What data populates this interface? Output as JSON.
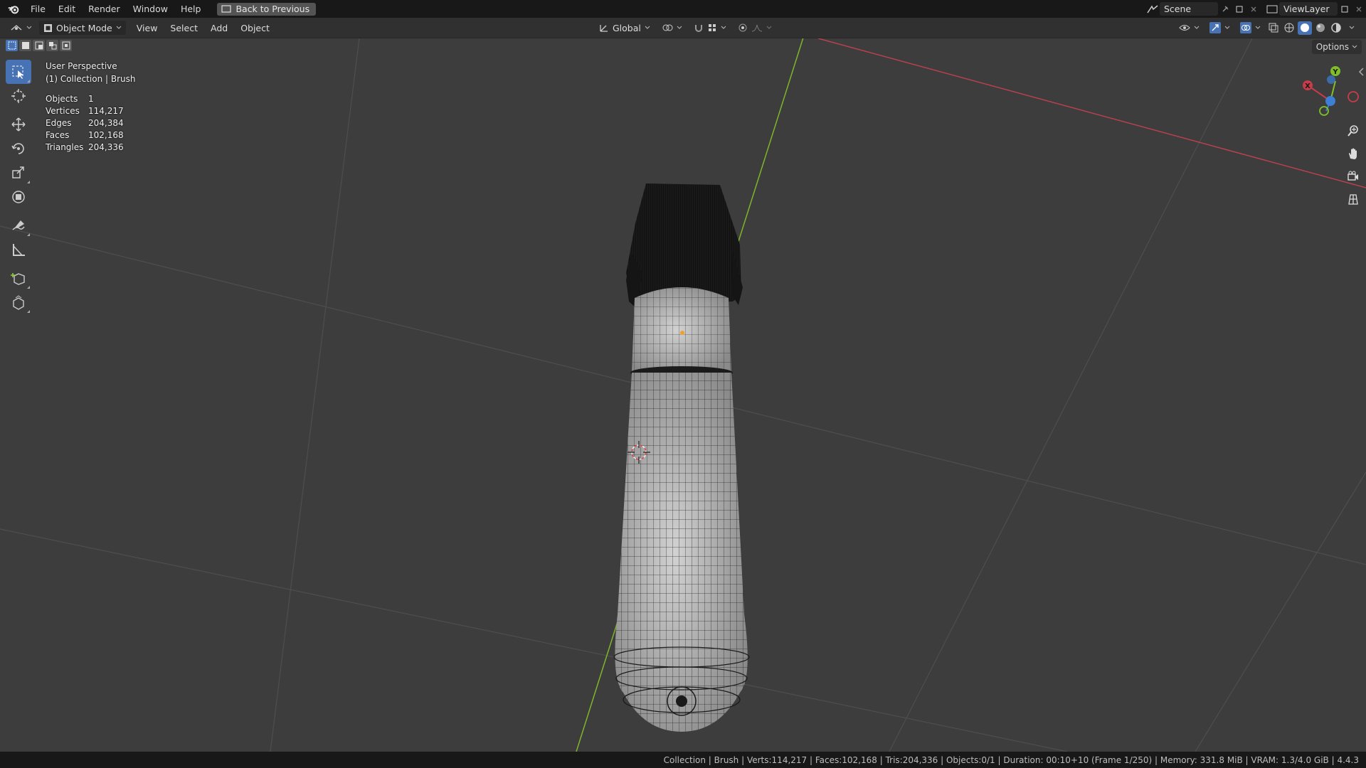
{
  "topbar": {
    "menus": [
      "File",
      "Edit",
      "Render",
      "Window",
      "Help"
    ],
    "back_button": "Back to Previous",
    "scene": "Scene",
    "view_layer": "ViewLayer"
  },
  "header": {
    "mode": "Object Mode",
    "menus": [
      "View",
      "Select",
      "Add",
      "Object"
    ],
    "transform_orientation": "Global",
    "options": "Options"
  },
  "overlay": {
    "view_name": "User Perspective",
    "collection": "(1) Collection | Brush",
    "stats": [
      {
        "label": "Objects",
        "value": "1"
      },
      {
        "label": "Vertices",
        "value": "114,217"
      },
      {
        "label": "Edges",
        "value": "204,384"
      },
      {
        "label": "Faces",
        "value": "102,168"
      },
      {
        "label": "Triangles",
        "value": "204,336"
      }
    ]
  },
  "gizmo": {
    "x": "X",
    "y": "Y"
  },
  "status": "Collection | Brush | Verts:114,217 | Faces:102,168 | Tris:204,336 | Objects:0/1 | Duration: 00:10+10 (Frame 1/250) | Memory: 331.8 MiB | VRAM: 1.3/4.0 GiB | 4.4.3",
  "colors": {
    "accent": "#4772b3",
    "x_axis": "#c83c4a",
    "y_axis": "#7fbf2a",
    "z_axis": "#3d7fd6"
  }
}
